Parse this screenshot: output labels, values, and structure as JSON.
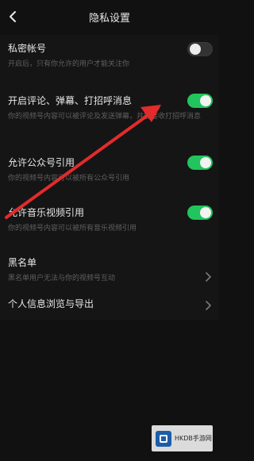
{
  "header": {
    "title": "隐私设置"
  },
  "settings": [
    {
      "label": "私密帐号",
      "description": "开启后，只有你允许的用户才能关注你",
      "toggle": "off"
    },
    {
      "label": "开启评论、弹幕、打招呼消息",
      "description": "你的视频号内容可以被评论及发送弹幕，并能接收打招呼消息",
      "toggle": "on"
    },
    {
      "label": "允许公众号引用",
      "description": "你的视频号内容可以被所有公众号引用",
      "toggle": "on"
    },
    {
      "label": "允许音乐视频引用",
      "description": "你的视频号内容可以被所有音乐视频引用",
      "toggle": "on"
    },
    {
      "label": "黑名单",
      "description": "黑名单用户无法与你的视频号互动",
      "chevron": true
    },
    {
      "label": "个人信息浏览与导出",
      "chevron": true
    }
  ],
  "watermark": {
    "text": "HKDB手游网"
  },
  "colors": {
    "background": "#111111",
    "toggle_on": "#21c45d",
    "arrow": "#e22b2b"
  },
  "icons": {
    "back": "back-icon",
    "chevron": "chevron-right-icon"
  }
}
